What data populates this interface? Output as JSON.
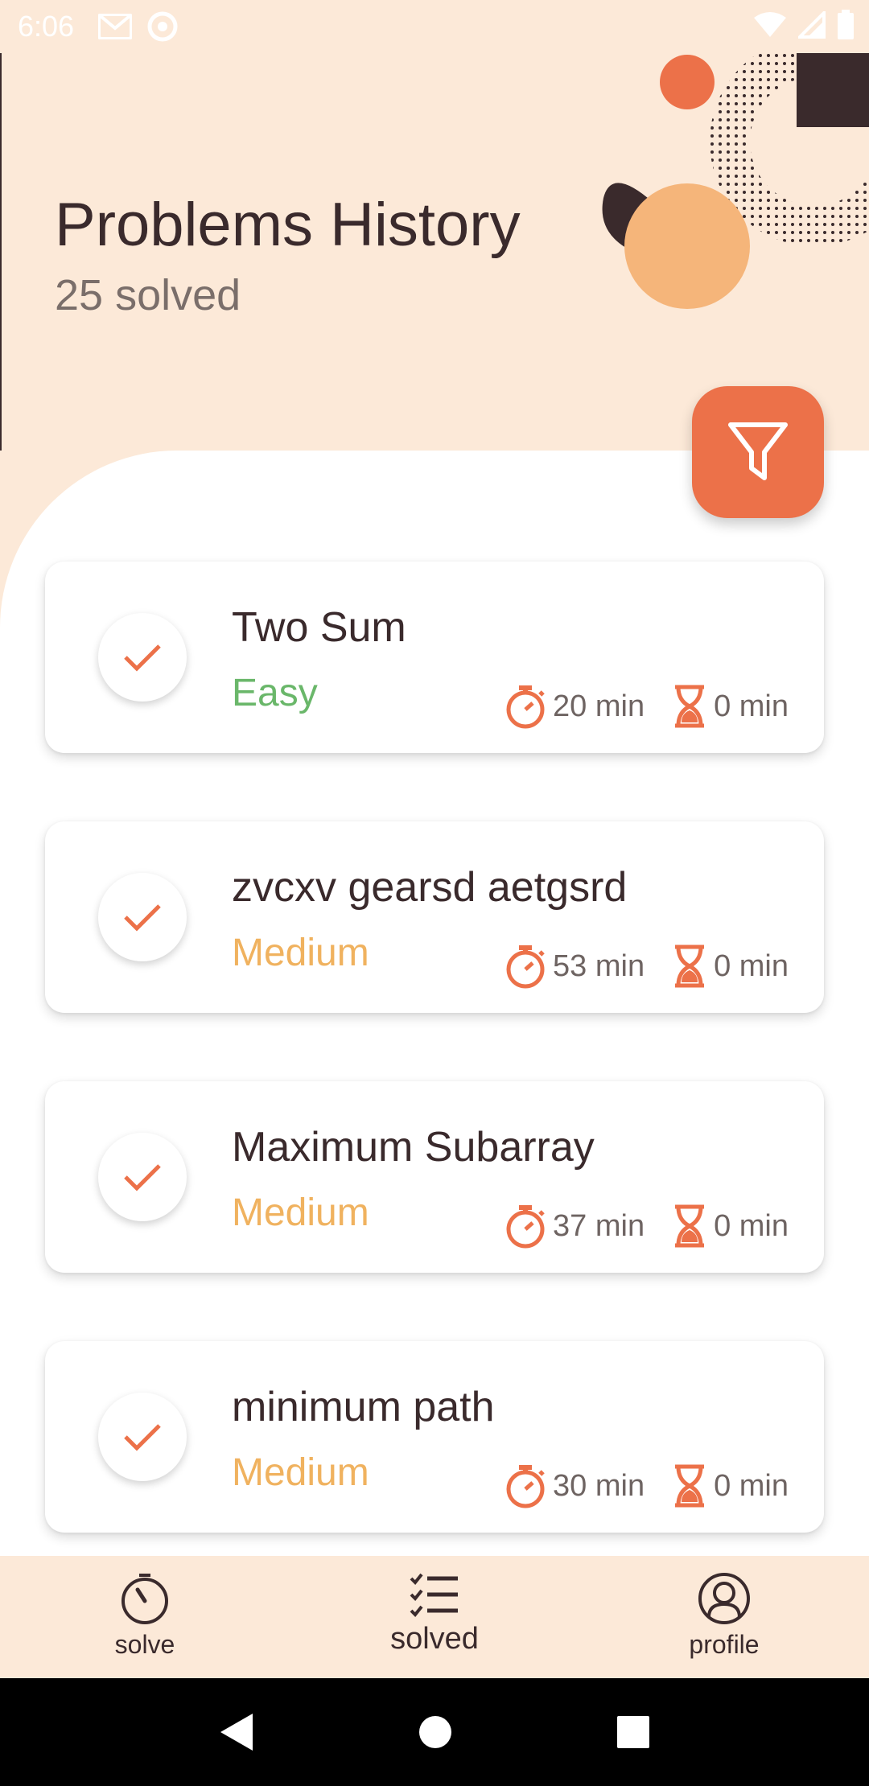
{
  "status_bar": {
    "time": "6:06"
  },
  "header": {
    "title": "Problems History",
    "subtitle": "25 solved"
  },
  "colors": {
    "accent": "#ec7149",
    "background": "#fce9d8",
    "easy": "#6ab76a",
    "medium": "#f0b25f",
    "dark": "#3a2a2c"
  },
  "filter_button": {
    "icon": "filter-icon"
  },
  "problems": [
    {
      "title": "Two Sum",
      "difficulty": "Easy",
      "time": "20 min",
      "hint_time": "0 min"
    },
    {
      "title": "zvcxv gearsd aetgsrd",
      "difficulty": "Medium",
      "time": "53 min",
      "hint_time": "0 min"
    },
    {
      "title": "Maximum Subarray",
      "difficulty": "Medium",
      "time": "37 min",
      "hint_time": "0 min"
    },
    {
      "title": "minimum path",
      "difficulty": "Medium",
      "time": "30 min",
      "hint_time": "0 min"
    }
  ],
  "bottom_nav": [
    {
      "label": "solve",
      "icon": "stopwatch-icon"
    },
    {
      "label": "solved",
      "icon": "checklist-icon",
      "active": true
    },
    {
      "label": "profile",
      "icon": "profile-icon"
    }
  ]
}
